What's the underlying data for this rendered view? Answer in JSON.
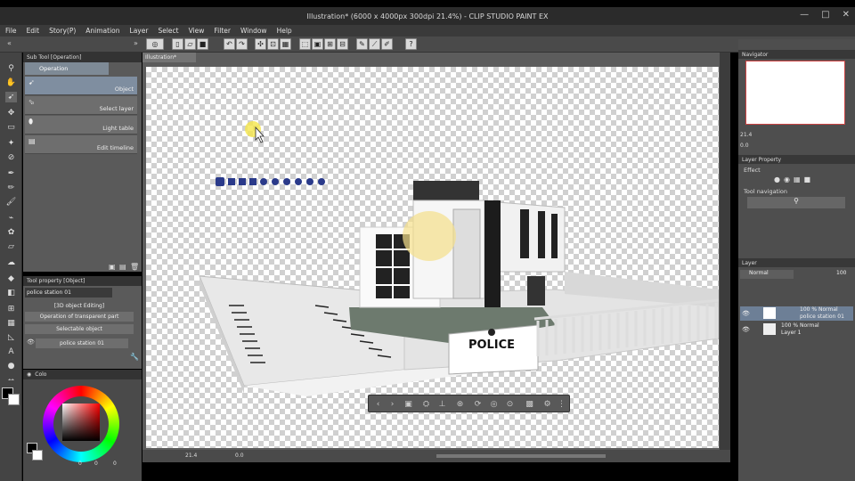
{
  "window": {
    "title": "Illustration* (6000 x 4000px 300dpi 21.4%) - CLIP STUDIO PAINT EX",
    "minimize": "—",
    "maximize": "□",
    "close": "✕"
  },
  "menu": [
    "File",
    "Edit",
    "Story(P)",
    "Animation",
    "Layer",
    "Select",
    "View",
    "Filter",
    "Window",
    "Help"
  ],
  "doc_tab": "Illustration*",
  "subtool": {
    "header": "Sub Tool [Operation]",
    "group": "Operation",
    "items": [
      "Object",
      "Select layer",
      "Light table",
      "Edit timeline"
    ]
  },
  "toolprop": {
    "header": "Tool property [Object]",
    "name": "police station 01",
    "mode": "[3D object Editing]",
    "transparent": "Operation of transparent part",
    "selectable": "Selectable object",
    "object": "police station 01"
  },
  "color": {
    "tab": "Colo",
    "values": [
      "0",
      "0",
      "0"
    ]
  },
  "navigator": {
    "header": "Navigator",
    "zoom": "21.4",
    "angle": "0.0"
  },
  "layerprop": {
    "header": "Layer Property",
    "effect": "Effect",
    "toolnav": "Tool navigation"
  },
  "layers": {
    "header": "Layer",
    "blend": "Normal",
    "opacity": "100",
    "items": [
      {
        "pct": "100 % Normal",
        "name": "police station 01"
      },
      {
        "pct": "100 % Normal",
        "name": "Layer 1"
      }
    ]
  },
  "canvas_text": {
    "sign": "POLICE"
  },
  "status": {
    "zoom": "21.4",
    "angle": "0.0"
  }
}
